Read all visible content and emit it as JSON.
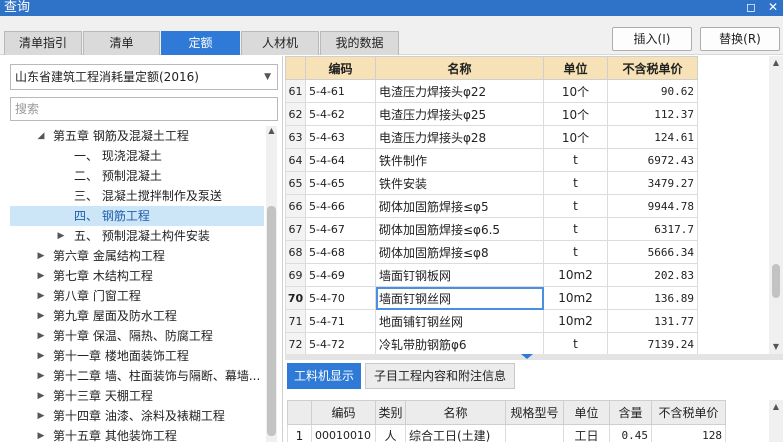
{
  "window": {
    "title": "查询"
  },
  "tabs": [
    {
      "label": "清单指引",
      "active": false
    },
    {
      "label": "清单",
      "active": false
    },
    {
      "label": "定额",
      "active": true
    },
    {
      "label": "人材机",
      "active": false
    },
    {
      "label": "我的数据",
      "active": false
    }
  ],
  "actions": {
    "insert": "插入(I)",
    "replace": "替换(R)"
  },
  "library": {
    "selected": "山东省建筑工程消耗量定额(2016)"
  },
  "search": {
    "placeholder": "搜索"
  },
  "tree": [
    {
      "label": "第五章 钢筋及混凝土工程",
      "level": 1,
      "caret": "expanded"
    },
    {
      "label": "一、 现浇混凝土",
      "level": 2,
      "caret": "none"
    },
    {
      "label": "二、 预制混凝土",
      "level": 2,
      "caret": "none"
    },
    {
      "label": "三、 混凝土搅拌制作及泵送",
      "level": 2,
      "caret": "none"
    },
    {
      "label": "四、 钢筋工程",
      "level": 2,
      "caret": "none",
      "selected": true
    },
    {
      "label": "五、 预制混凝土构件安装",
      "level": 2,
      "caret": "collapsed"
    },
    {
      "label": "第六章 金属结构工程",
      "level": 1,
      "caret": "collapsed"
    },
    {
      "label": "第七章 木结构工程",
      "level": 1,
      "caret": "collapsed"
    },
    {
      "label": "第八章 门窗工程",
      "level": 1,
      "caret": "collapsed"
    },
    {
      "label": "第九章 屋面及防水工程",
      "level": 1,
      "caret": "collapsed"
    },
    {
      "label": "第十章 保温、隔热、防腐工程",
      "level": 1,
      "caret": "collapsed"
    },
    {
      "label": "第十一章 楼地面装饰工程",
      "level": 1,
      "caret": "collapsed"
    },
    {
      "label": "第十二章 墙、柱面装饰与隔断、幕墙...",
      "level": 1,
      "caret": "collapsed"
    },
    {
      "label": "第十三章 天棚工程",
      "level": 1,
      "caret": "collapsed"
    },
    {
      "label": "第十四章 油漆、涂料及裱糊工程",
      "level": 1,
      "caret": "collapsed"
    },
    {
      "label": "第十五章 其他装饰工程",
      "level": 1,
      "caret": "collapsed"
    }
  ],
  "grid": {
    "headers": [
      "",
      "编码",
      "名称",
      "单位",
      "不含税单价"
    ],
    "rows": [
      {
        "n": "61",
        "code": "5-4-61",
        "name": "电渣压力焊接头φ22",
        "unit": "10个",
        "price": "90.62"
      },
      {
        "n": "62",
        "code": "5-4-62",
        "name": "电渣压力焊接头φ25",
        "unit": "10个",
        "price": "112.37"
      },
      {
        "n": "63",
        "code": "5-4-63",
        "name": "电渣压力焊接头φ28",
        "unit": "10个",
        "price": "124.61"
      },
      {
        "n": "64",
        "code": "5-4-64",
        "name": "铁件制作",
        "unit": "t",
        "price": "6972.43"
      },
      {
        "n": "65",
        "code": "5-4-65",
        "name": "铁件安装",
        "unit": "t",
        "price": "3479.27"
      },
      {
        "n": "66",
        "code": "5-4-66",
        "name": "砌体加固筋焊接≤φ5",
        "unit": "t",
        "price": "9944.78"
      },
      {
        "n": "67",
        "code": "5-4-67",
        "name": "砌体加固筋焊接≤φ6.5",
        "unit": "t",
        "price": "6317.7"
      },
      {
        "n": "68",
        "code": "5-4-68",
        "name": "砌体加固筋焊接≤φ8",
        "unit": "t",
        "price": "5666.34"
      },
      {
        "n": "69",
        "code": "5-4-69",
        "name": "墙面钉钢板网",
        "unit": "10m2",
        "price": "202.83"
      },
      {
        "n": "70",
        "code": "5-4-70",
        "name": "墙面钉钢丝网",
        "unit": "10m2",
        "price": "136.89",
        "active": true
      },
      {
        "n": "71",
        "code": "5-4-71",
        "name": "地面铺钉钢丝网",
        "unit": "10m2",
        "price": "131.77"
      },
      {
        "n": "72",
        "code": "5-4-72",
        "name": "冷轧带肋钢筋φ6",
        "unit": "t",
        "price": "7139.24"
      }
    ]
  },
  "bottom_tabs": [
    {
      "label": "工料机显示",
      "active": true
    },
    {
      "label": "子目工程内容和附注信息",
      "active": false
    }
  ],
  "bottom_grid": {
    "headers": [
      "",
      "编码",
      "类别",
      "名称",
      "规格型号",
      "单位",
      "含量",
      "不含税单价"
    ],
    "rows": [
      {
        "n": "1",
        "code": "00010010",
        "type": "人",
        "name": "综合工日(土建)",
        "spec": "",
        "unit": "工日",
        "qty": "0.45",
        "price": "128"
      }
    ]
  }
}
